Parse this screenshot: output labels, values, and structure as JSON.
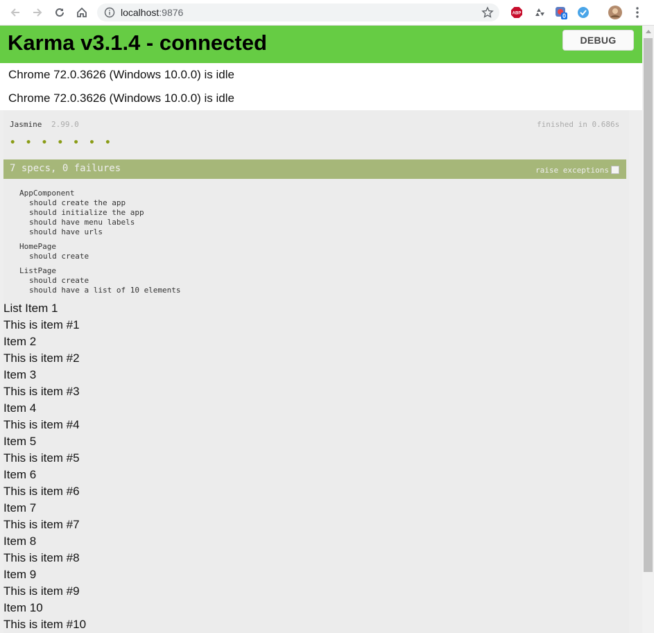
{
  "browser": {
    "url_host": "localhost",
    "url_port": ":9876",
    "icons": [
      "back-icon",
      "forward-icon",
      "reload-icon",
      "home-icon",
      "info-icon",
      "star-icon",
      "adblock-icon",
      "recycle-icon",
      "extension-icon",
      "extension-badge",
      "tampermonkey-icon",
      "profile-avatar",
      "menu-icon"
    ],
    "ext_badge_count": "0",
    "abp_label": "ABP"
  },
  "karma": {
    "title": "Karma v3.1.4 - connected",
    "debug_label": "DEBUG",
    "browsers": [
      "Chrome 72.0.3626 (Windows 10.0.0) is idle",
      "Chrome 72.0.3626 (Windows 10.0.0) is idle"
    ],
    "banner_color": "#66cc44"
  },
  "jasmine": {
    "title": "Jasmine",
    "version": "2.99.0",
    "duration": "finished in 0.686s",
    "dots": "•••••••",
    "summary": "7 specs, 0 failures",
    "raise_exceptions_label": "raise exceptions",
    "suites": [
      {
        "name": "AppComponent",
        "specs": [
          "should create the app",
          "should initialize the app",
          "should have menu labels",
          "should have urls"
        ]
      },
      {
        "name": "HomePage",
        "specs": [
          "should create"
        ]
      },
      {
        "name": "ListPage",
        "specs": [
          "should create",
          "should have a list of 10 elements"
        ]
      }
    ],
    "bar_color": "#a6b779"
  },
  "list_output": [
    "List Item 1",
    "This is item #1",
    "Item 2",
    "This is item #2",
    "Item 3",
    "This is item #3",
    "Item 4",
    "This is item #4",
    "Item 5",
    "This is item #5",
    "Item 6",
    "This is item #6",
    "Item 7",
    "This is item #7",
    "Item 8",
    "This is item #8",
    "Item 9",
    "This is item #9",
    "Item 10",
    "This is item #10"
  ]
}
